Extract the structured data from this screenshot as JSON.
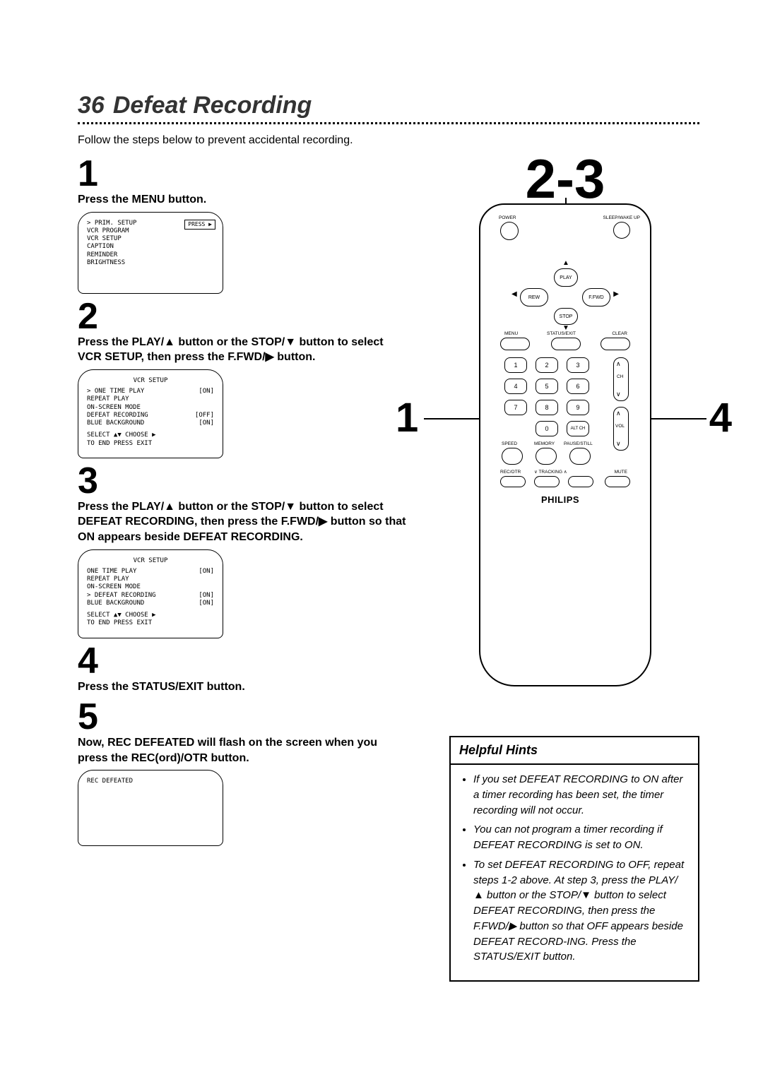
{
  "header": {
    "page_number": "36",
    "title": "Defeat Recording"
  },
  "intro": "Follow the steps below to prevent accidental recording.",
  "steps": {
    "s1": {
      "num": "1",
      "text": "Press the MENU button."
    },
    "s2": {
      "num": "2",
      "text": "Press the PLAY/▲ button or the STOP/▼ button to select VCR SETUP, then press the F.FWD/▶ button."
    },
    "s3": {
      "num": "3",
      "text": "Press the PLAY/▲ button or the STOP/▼ button to select DEFEAT RECORDING, then press the F.FWD/▶ button so that ON appears beside DEFEAT RECORDING."
    },
    "s4": {
      "num": "4",
      "text": "Press the STATUS/EXIT button."
    },
    "s5": {
      "num": "5",
      "text": "Now, REC DEFEATED will flash on the screen when you press the REC(ord)/OTR button."
    }
  },
  "screens": {
    "a": {
      "press_label": "PRESS ▶",
      "lines": [
        "> PRIM. SETUP",
        "  VCR PROGRAM",
        "  VCR SETUP",
        "  CAPTION",
        "  REMINDER",
        "  BRIGHTNESS"
      ]
    },
    "b": {
      "title": "VCR SETUP",
      "rows": [
        {
          "l": "> ONE TIME PLAY",
          "r": "[ON]"
        },
        {
          "l": "  REPEAT PLAY",
          "r": ""
        },
        {
          "l": "  ON-SCREEN MODE",
          "r": ""
        },
        {
          "l": "  DEFEAT RECORDING",
          "r": "[OFF]"
        },
        {
          "l": "  BLUE BACKGROUND",
          "r": "[ON]"
        }
      ],
      "foot1": "SELECT ▲▼ CHOOSE ▶",
      "foot2": "TO END PRESS EXIT"
    },
    "c": {
      "title": "VCR SETUP",
      "rows": [
        {
          "l": "  ONE TIME PLAY",
          "r": "[ON]"
        },
        {
          "l": "  REPEAT PLAY",
          "r": ""
        },
        {
          "l": "  ON-SCREEN MODE",
          "r": ""
        },
        {
          "l": "> DEFEAT RECORDING",
          "r": "[ON]"
        },
        {
          "l": "  BLUE BACKGROUND",
          "r": "[ON]"
        }
      ],
      "foot1": "SELECT ▲▼ CHOOSE ▶",
      "foot2": "TO END PRESS EXIT"
    },
    "d": {
      "line": "REC DEFEATED"
    }
  },
  "remote": {
    "callout_top": "2-3",
    "callout_left": "1",
    "callout_right": "4",
    "labels": {
      "power": "POWER",
      "sleep": "SLEEP/WAKE UP",
      "play": "PLAY",
      "rew": "REW",
      "ffwd": "F.FWD",
      "stop": "STOP",
      "menu": "MENU",
      "status": "STATUS/EXIT",
      "clear": "CLEAR",
      "speed": "SPEED",
      "memory": "MEMORY",
      "pause": "PAUSE/STILL",
      "recotr": "REC/OTR",
      "tracking_down": "∨ TRACKING ∧",
      "mute": "MUTE",
      "altch": "ALT CH",
      "ch": "CH",
      "vol": "VOL"
    },
    "keypad": [
      "1",
      "2",
      "3",
      "4",
      "5",
      "6",
      "7",
      "8",
      "9",
      "0"
    ],
    "brand": "PHILIPS"
  },
  "hints": {
    "title": "Helpful Hints",
    "items": [
      "If you set DEFEAT RECORDING to ON after a timer recording has been set, the timer recording will not occur.",
      "You can not program a timer recording if DEFEAT RECORDING is set to ON.",
      "To set DEFEAT RECORDING to OFF, repeat steps 1-2 above. At step 3, press the PLAY/▲ button or the STOP/▼ button to select DEFEAT RECORDING, then press the F.FWD/▶ button so that OFF appears beside DEFEAT RECORD-ING. Press the STATUS/EXIT button."
    ]
  }
}
